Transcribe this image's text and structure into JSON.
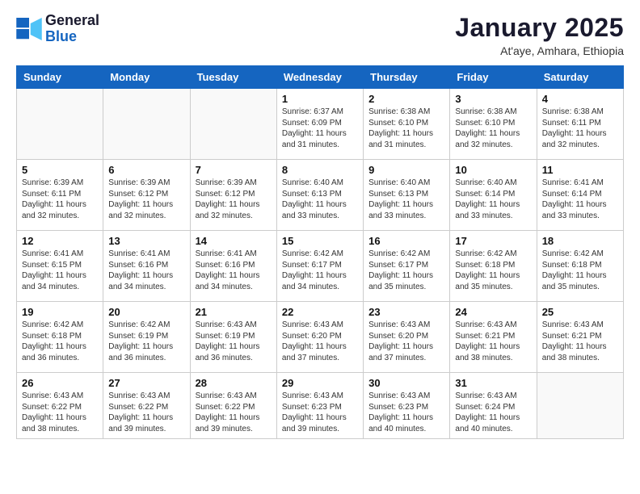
{
  "logo": {
    "line1": "General",
    "line2": "Blue"
  },
  "title": "January 2025",
  "subtitle": "At'aye, Amhara, Ethiopia",
  "days_of_week": [
    "Sunday",
    "Monday",
    "Tuesday",
    "Wednesday",
    "Thursday",
    "Friday",
    "Saturday"
  ],
  "weeks": [
    [
      {
        "day": "",
        "info": ""
      },
      {
        "day": "",
        "info": ""
      },
      {
        "day": "",
        "info": ""
      },
      {
        "day": "1",
        "info": "Sunrise: 6:37 AM\nSunset: 6:09 PM\nDaylight: 11 hours\nand 31 minutes."
      },
      {
        "day": "2",
        "info": "Sunrise: 6:38 AM\nSunset: 6:10 PM\nDaylight: 11 hours\nand 31 minutes."
      },
      {
        "day": "3",
        "info": "Sunrise: 6:38 AM\nSunset: 6:10 PM\nDaylight: 11 hours\nand 32 minutes."
      },
      {
        "day": "4",
        "info": "Sunrise: 6:38 AM\nSunset: 6:11 PM\nDaylight: 11 hours\nand 32 minutes."
      }
    ],
    [
      {
        "day": "5",
        "info": "Sunrise: 6:39 AM\nSunset: 6:11 PM\nDaylight: 11 hours\nand 32 minutes."
      },
      {
        "day": "6",
        "info": "Sunrise: 6:39 AM\nSunset: 6:12 PM\nDaylight: 11 hours\nand 32 minutes."
      },
      {
        "day": "7",
        "info": "Sunrise: 6:39 AM\nSunset: 6:12 PM\nDaylight: 11 hours\nand 32 minutes."
      },
      {
        "day": "8",
        "info": "Sunrise: 6:40 AM\nSunset: 6:13 PM\nDaylight: 11 hours\nand 33 minutes."
      },
      {
        "day": "9",
        "info": "Sunrise: 6:40 AM\nSunset: 6:13 PM\nDaylight: 11 hours\nand 33 minutes."
      },
      {
        "day": "10",
        "info": "Sunrise: 6:40 AM\nSunset: 6:14 PM\nDaylight: 11 hours\nand 33 minutes."
      },
      {
        "day": "11",
        "info": "Sunrise: 6:41 AM\nSunset: 6:14 PM\nDaylight: 11 hours\nand 33 minutes."
      }
    ],
    [
      {
        "day": "12",
        "info": "Sunrise: 6:41 AM\nSunset: 6:15 PM\nDaylight: 11 hours\nand 34 minutes."
      },
      {
        "day": "13",
        "info": "Sunrise: 6:41 AM\nSunset: 6:16 PM\nDaylight: 11 hours\nand 34 minutes."
      },
      {
        "day": "14",
        "info": "Sunrise: 6:41 AM\nSunset: 6:16 PM\nDaylight: 11 hours\nand 34 minutes."
      },
      {
        "day": "15",
        "info": "Sunrise: 6:42 AM\nSunset: 6:17 PM\nDaylight: 11 hours\nand 34 minutes."
      },
      {
        "day": "16",
        "info": "Sunrise: 6:42 AM\nSunset: 6:17 PM\nDaylight: 11 hours\nand 35 minutes."
      },
      {
        "day": "17",
        "info": "Sunrise: 6:42 AM\nSunset: 6:18 PM\nDaylight: 11 hours\nand 35 minutes."
      },
      {
        "day": "18",
        "info": "Sunrise: 6:42 AM\nSunset: 6:18 PM\nDaylight: 11 hours\nand 35 minutes."
      }
    ],
    [
      {
        "day": "19",
        "info": "Sunrise: 6:42 AM\nSunset: 6:18 PM\nDaylight: 11 hours\nand 36 minutes."
      },
      {
        "day": "20",
        "info": "Sunrise: 6:42 AM\nSunset: 6:19 PM\nDaylight: 11 hours\nand 36 minutes."
      },
      {
        "day": "21",
        "info": "Sunrise: 6:43 AM\nSunset: 6:19 PM\nDaylight: 11 hours\nand 36 minutes."
      },
      {
        "day": "22",
        "info": "Sunrise: 6:43 AM\nSunset: 6:20 PM\nDaylight: 11 hours\nand 37 minutes."
      },
      {
        "day": "23",
        "info": "Sunrise: 6:43 AM\nSunset: 6:20 PM\nDaylight: 11 hours\nand 37 minutes."
      },
      {
        "day": "24",
        "info": "Sunrise: 6:43 AM\nSunset: 6:21 PM\nDaylight: 11 hours\nand 38 minutes."
      },
      {
        "day": "25",
        "info": "Sunrise: 6:43 AM\nSunset: 6:21 PM\nDaylight: 11 hours\nand 38 minutes."
      }
    ],
    [
      {
        "day": "26",
        "info": "Sunrise: 6:43 AM\nSunset: 6:22 PM\nDaylight: 11 hours\nand 38 minutes."
      },
      {
        "day": "27",
        "info": "Sunrise: 6:43 AM\nSunset: 6:22 PM\nDaylight: 11 hours\nand 39 minutes."
      },
      {
        "day": "28",
        "info": "Sunrise: 6:43 AM\nSunset: 6:22 PM\nDaylight: 11 hours\nand 39 minutes."
      },
      {
        "day": "29",
        "info": "Sunrise: 6:43 AM\nSunset: 6:23 PM\nDaylight: 11 hours\nand 39 minutes."
      },
      {
        "day": "30",
        "info": "Sunrise: 6:43 AM\nSunset: 6:23 PM\nDaylight: 11 hours\nand 40 minutes."
      },
      {
        "day": "31",
        "info": "Sunrise: 6:43 AM\nSunset: 6:24 PM\nDaylight: 11 hours\nand 40 minutes."
      },
      {
        "day": "",
        "info": ""
      }
    ]
  ]
}
